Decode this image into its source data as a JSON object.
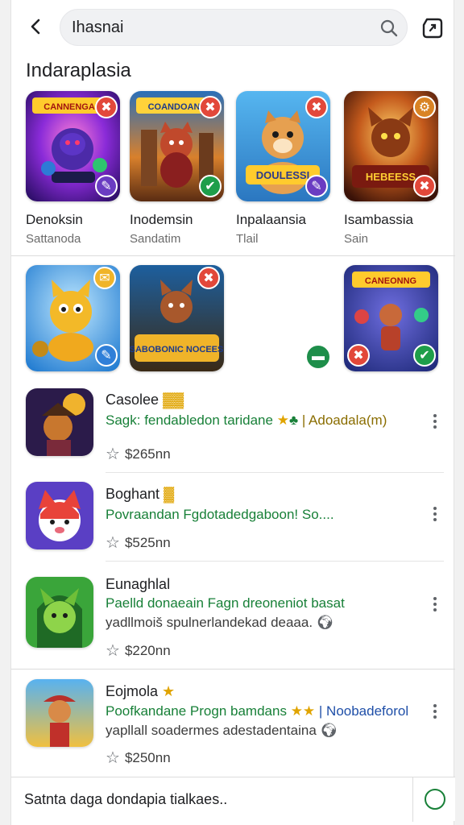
{
  "search": {
    "value": "Ihasnai"
  },
  "icons": {
    "back": "arrow-back-icon",
    "search": "search-icon",
    "share": "share-icon"
  },
  "section": {
    "title": "Indaraplasia"
  },
  "featured": [
    {
      "name": "Denoksin",
      "sub": "Sattanoda",
      "art": "CANNENGAR"
    },
    {
      "name": "Inodemsin",
      "sub": "Sandatim",
      "art": "COANDOAN"
    },
    {
      "name": "Inpalaansia",
      "sub": "Tlail",
      "art": "DOULESSI"
    },
    {
      "name": "Isambassia",
      "sub": "Sain",
      "art": "HEBEESS"
    }
  ],
  "second_row": [
    {
      "art": ""
    },
    {
      "art": "SABOBONIC NOCEES"
    },
    {
      "art": ""
    },
    {
      "art": "CANEONNG"
    }
  ],
  "list": [
    {
      "title": "Casolee",
      "badge": "▓▓",
      "desc": "Sagk: fendabledon taridane",
      "desc_tag": "| Adoadala(m)",
      "extra": "",
      "price": "$265nn"
    },
    {
      "title": "Boghant",
      "badge": "▓",
      "desc": "Povraandan Fgdotadedgaboon! So....",
      "desc_tag": "",
      "extra": "",
      "price": "$525nn"
    },
    {
      "title": "Eunaghlal",
      "badge": "",
      "desc": "Paelld donaeain Fagn dreoneniot basat",
      "desc_tag": "",
      "extra": "yadllmoiš spulnerlandekad deaaa.",
      "price": "$220nn"
    },
    {
      "title": "Eojmola",
      "badge": "★",
      "desc": "Poofkandane Progn bamdans",
      "desc_tag": "| Noobadeforol",
      "extra": "yapllall soadermes adestadentaina",
      "price": "$250nn"
    }
  ],
  "bottom": {
    "text": "Satnta daga dondapia tialkaes.."
  },
  "colors": {
    "green": "#188038",
    "gold": "#e0a400"
  }
}
